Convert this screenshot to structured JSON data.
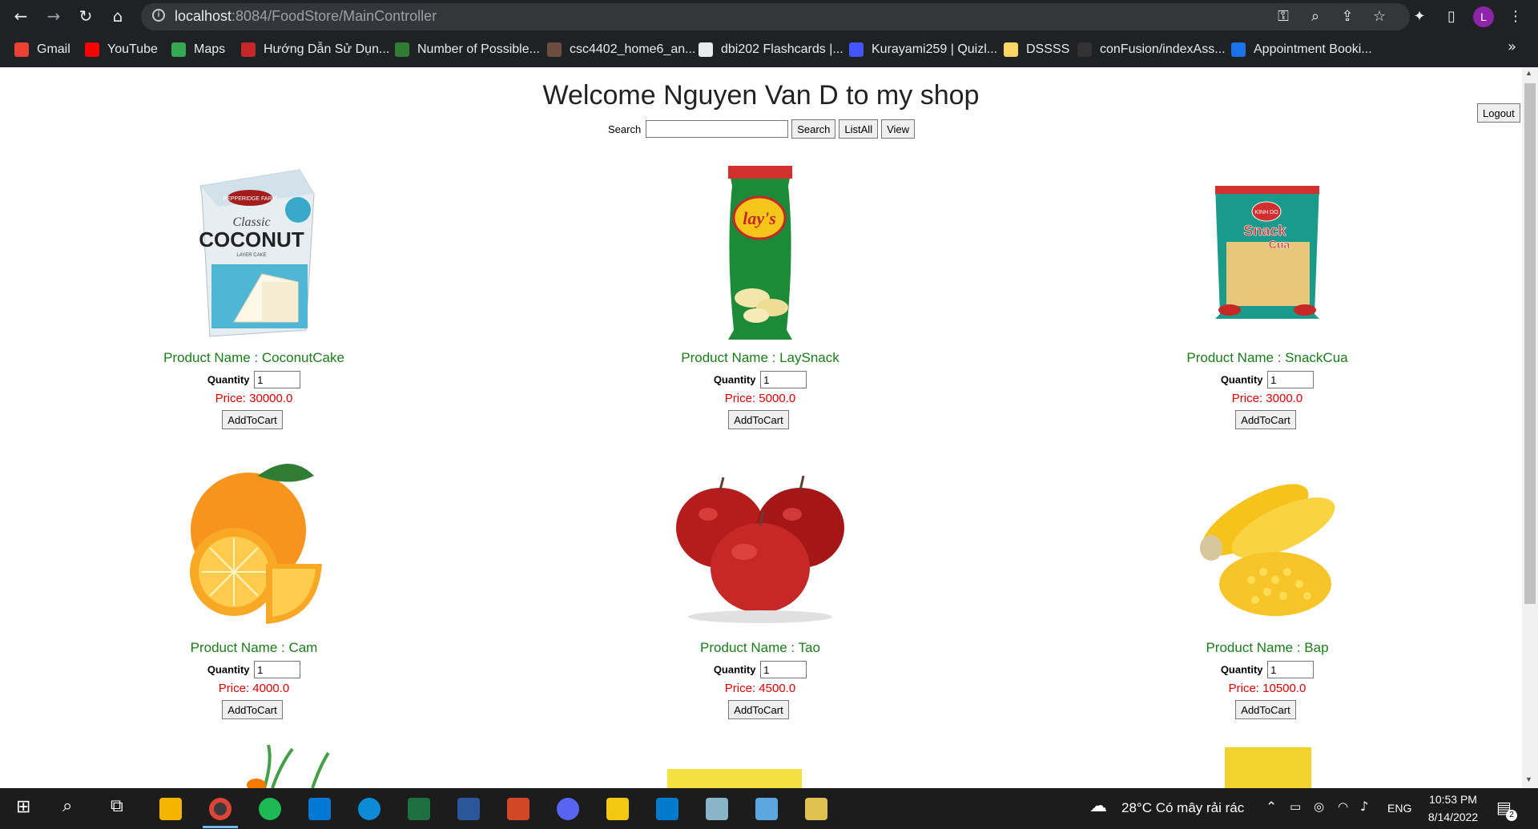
{
  "browser": {
    "url_host": "localhost",
    "url_rest": ":8084/FoodStore/MainController",
    "bookmarks": [
      {
        "label": "Gmail",
        "color": "#ea4335"
      },
      {
        "label": "YouTube",
        "color": "#ff0000"
      },
      {
        "label": "Maps",
        "color": "#34a853"
      },
      {
        "label": "Hướng Dẫn Sử Dụn...",
        "color": "#c62828"
      },
      {
        "label": "Number of Possible...",
        "color": "#2e7d32"
      },
      {
        "label": "csc4402_home6_an...",
        "color": "#6d4c41"
      },
      {
        "label": "dbi202 Flashcards |...",
        "color": "#e8eaed"
      },
      {
        "label": "Kurayami259 | Quizl...",
        "color": "#4255ff"
      },
      {
        "label": "DSSSS",
        "color": "#fdd663"
      },
      {
        "label": "conFusion/indexAss...",
        "color": "#333333"
      },
      {
        "label": "Appointment Booki...",
        "color": "#1a73e8"
      }
    ],
    "more": "»",
    "avatar_letter": "L"
  },
  "header": {
    "title": "Welcome Nguyen Van D to my shop",
    "search_label": "Search",
    "search_value": "",
    "search_button": "Search",
    "listall_button": "ListAll",
    "view_button": "View",
    "logout_button": "Logout"
  },
  "products": [
    {
      "name": "Product Name : CoconutCake",
      "qty_label": "Quantity",
      "qty": "1",
      "price": "Price: 30000.0",
      "button": "AddToCart",
      "image": "coconut-cake-box"
    },
    {
      "name": "Product Name : LaySnack",
      "qty_label": "Quantity",
      "qty": "1",
      "price": "Price: 5000.0",
      "button": "AddToCart",
      "image": "lays-chips-bag"
    },
    {
      "name": "Product Name : SnackCua",
      "qty_label": "Quantity",
      "qty": "1",
      "price": "Price: 3000.0",
      "button": "AddToCart",
      "image": "snack-cua-bag"
    },
    {
      "name": "Product Name : Cam",
      "qty_label": "Quantity",
      "qty": "1",
      "price": "Price: 4000.0",
      "button": "AddToCart",
      "image": "orange"
    },
    {
      "name": "Product Name : Tao",
      "qty_label": "Quantity",
      "qty": "1",
      "price": "Price: 4500.0",
      "button": "AddToCart",
      "image": "apples"
    },
    {
      "name": "Product Name : Bap",
      "qty_label": "Quantity",
      "qty": "1",
      "price": "Price: 10500.0",
      "button": "AddToCart",
      "image": "corn"
    }
  ],
  "product_images": {
    "coconut_brand": "PEPPERIDGE FARM",
    "coconut_classic": "Classic",
    "coconut_word": "COCONUT",
    "coconut_sub": "LAYER CAKE",
    "lays_word": "lay's",
    "snack_brand": "KINH DO",
    "snack_word": "Snack",
    "snack_cua": "Cua"
  },
  "taskbar": {
    "weather": "28°C  Có mây rải rác",
    "lang": "ENG",
    "time": "10:53 PM",
    "date": "8/14/2022",
    "notifications": "2"
  }
}
